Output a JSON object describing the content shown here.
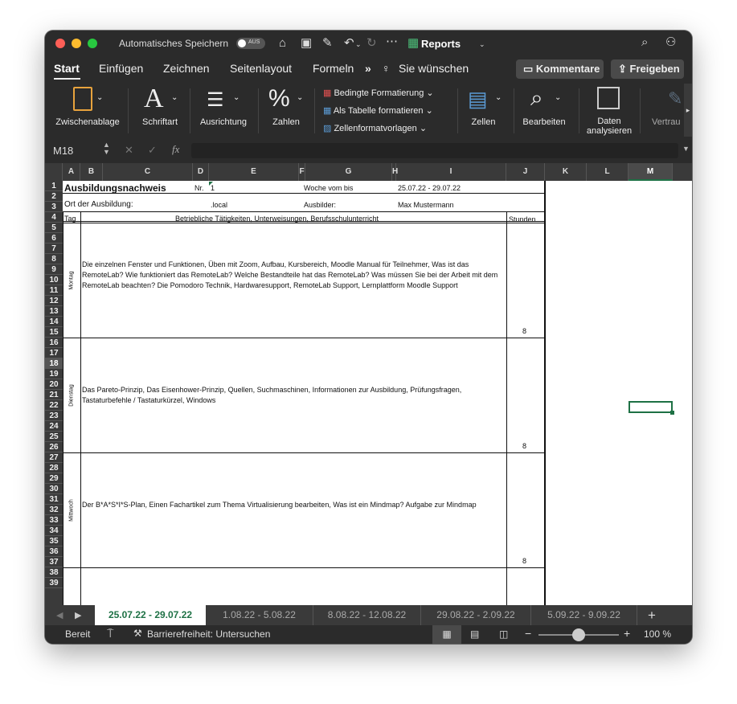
{
  "titlebar": {
    "autosave_label": "Automatisches Speichern",
    "autosave_state": "AUS",
    "app_title": "Reports"
  },
  "tabs": {
    "items": [
      "Start",
      "Einfügen",
      "Zeichnen",
      "Seitenlayout",
      "Formeln"
    ],
    "more": "»",
    "tell_me": "Sie wünschen",
    "comments_btn": "Kommentare",
    "share_btn": "Freigeben"
  },
  "ribbon": {
    "clipboard": "Zwischenablage",
    "font": "Schriftart",
    "alignment": "Ausrichtung",
    "number": "Zahlen",
    "cond_format": "Bedingte Formatierung",
    "format_table": "Als Tabelle formatieren",
    "cell_styles": "Zellenformatvorlagen",
    "cells": "Zellen",
    "edit": "Bearbeiten",
    "analyze1": "Daten",
    "analyze2": "analysieren",
    "trust": "Vertrau"
  },
  "formula_bar": {
    "name_box": "M18",
    "fx": "fx",
    "value": ""
  },
  "columns": [
    "A",
    "B",
    "C",
    "D",
    "E",
    "F",
    "G",
    "H",
    "I",
    "J",
    "K",
    "L",
    "M"
  ],
  "rows": [
    "1",
    "2",
    "3",
    "4",
    "5",
    "6",
    "7",
    "8",
    "9",
    "10",
    "11",
    "12",
    "13",
    "14",
    "15",
    "16",
    "17",
    "18",
    "19",
    "20",
    "21",
    "22",
    "23",
    "24",
    "25",
    "26",
    "27",
    "28",
    "29",
    "30",
    "31",
    "32",
    "33",
    "34",
    "35",
    "36",
    "37",
    "38",
    "39"
  ],
  "sheet": {
    "title": "Ausbildungsnachweis",
    "nr_label": "Nr.",
    "nr_value": "1",
    "week_label": "Woche vom bis",
    "week_value": "25.07.22 - 29.07.22",
    "place_label": "Ort der Ausbildung:",
    "place_value": ".local",
    "trainer_label": "Ausbilder:",
    "trainer_value": "Max Mustermann",
    "col_day": "Tag",
    "col_activities": "Betriebliche Tätigkeiten, Unterweisungen, Berufsschulunterricht",
    "col_hours": "Stunden",
    "days": [
      {
        "name": "Montag",
        "text": "Die einzelnen Fenster und Funktionen, Üben mit Zoom, Aufbau, Kursbereich, Moodle Manual für Teilnehmer, Was ist das RemoteLab? Wie funktioniert das RemoteLab? Welche Bestandteile hat das RemoteLab? Was müssen Sie bei der Arbeit mit dem RemoteLab beachten? Die Pomodoro Technik, Hardwaresupport, RemoteLab Support, Lernplattform Moodle Support",
        "hours": "8"
      },
      {
        "name": "Dienstag",
        "text": "Das Pareto-Prinzip, Das Eisenhower-Prinzip, Quellen, Suchmaschinen, Informationen zur Ausbildung, Prüfungsfragen, Tastaturbefehle / Tastaturkürzel, Windows",
        "hours": "8"
      },
      {
        "name": "Mittwoch",
        "text": "Der B*A*S*I*S-Plan, Einen Fachartikel zum Thema Virtualisierung bearbeiten, Was ist ein Mindmap? Aufgabe zur Mindmap",
        "hours": "8"
      }
    ]
  },
  "sheet_tabs": [
    "25.07.22 - 29.07.22",
    "1.08.22 - 5.08.22",
    "8.08.22 - 12.08.22",
    "29.08.22 - 2.09.22",
    "5.09.22 - 9.09.22"
  ],
  "add_sheet": "+",
  "status": {
    "ready": "Bereit",
    "accessibility": "Barrierefreiheit: Untersuchen",
    "zoom": "100 %",
    "zoom_fraction": 0.5
  },
  "colors": {
    "accent_green": "#1e7145",
    "selected_tab_bg": "#ffffff"
  }
}
